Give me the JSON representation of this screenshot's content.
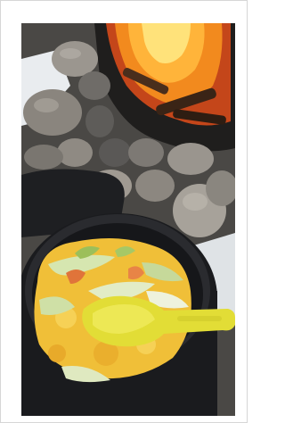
{
  "photo": {
    "alt": "",
    "scene_elements": [
      "campfire",
      "stone-ring",
      "snow",
      "cooking-pot",
      "scrambled-eggs-with-vegetables",
      "yellow-spork"
    ]
  },
  "colors": {
    "background": "#ffffff",
    "frame_border": "#d6d6d6",
    "fire_orange": "#f28a1e",
    "fire_yellow": "#ffd24a",
    "rock_gray": "#8e8a84",
    "pot_black": "#1c1d20",
    "egg_yellow": "#f2c23a",
    "cabbage_green": "#cfe0a8",
    "carrot_orange": "#e07a3a",
    "spork_yellow": "#e6e23a"
  }
}
